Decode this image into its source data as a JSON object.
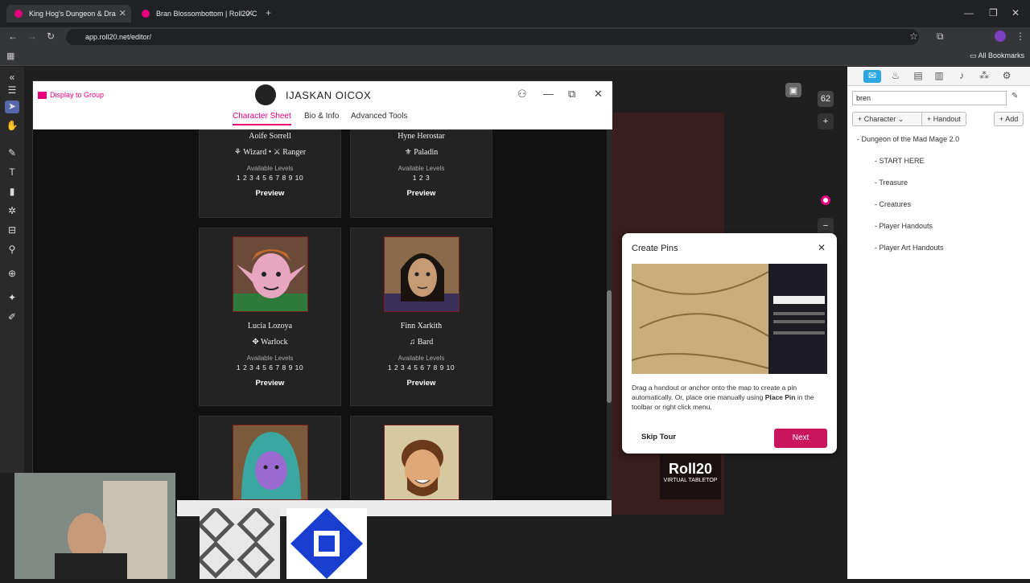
{
  "browser": {
    "tabs": [
      {
        "title": "King Hog's Dungeon & Dra",
        "active": true
      },
      {
        "title": "Bran Blossombottom | Roll20 C",
        "active": false
      }
    ],
    "new_tab": "+",
    "url": "app.roll20.net/editor/",
    "all_bookmarks": "All Bookmarks"
  },
  "dialog": {
    "display_to_group": "Display to Group",
    "title": "IJASKAN OICOX",
    "tabs": [
      "Character Sheet",
      "Bio & Info",
      "Advanced Tools"
    ],
    "available_levels_label": "Available Levels",
    "preview_label": "Preview",
    "cards": [
      {
        "name": "Aoife Sorrell",
        "classes": [
          "Wizard",
          "Ranger"
        ],
        "levels": "1 2 3 4 5 6 7 8 9 10"
      },
      {
        "name": "Hyne Herostar",
        "classes": [
          "Paladin"
        ],
        "levels": "1 2 3"
      },
      {
        "name": "Lucia Lozoya",
        "classes": [
          "Warlock"
        ],
        "levels": "1 2 3 4 5 6 7 8 9 10"
      },
      {
        "name": "Finn Xarkith",
        "classes": [
          "Bard"
        ],
        "levels": "1 2 3 4 5 6 7 8 9 10"
      }
    ]
  },
  "tour": {
    "title": "Create Pins",
    "text_before": "Drag a handout or anchor onto the map to create a pin automatically. Or, place one manually using ",
    "text_bold": "Place Pin",
    "text_after": " in the toolbar or right click menu.",
    "skip": "Skip Tour",
    "next": "Next"
  },
  "right_panel": {
    "search_value": "bren",
    "character_btn": "Character",
    "handout_btn": "+ Handout",
    "add_btn": "+ Add",
    "folder": "Dungeon of the Mad Mage 2.0",
    "items": [
      "START HERE",
      "Treasure",
      "Creatures",
      "Player Handouts",
      "Player Art Handouts"
    ]
  },
  "strip": {
    "page_count": "62",
    "add": "+"
  },
  "logo": {
    "line1": "Roll20",
    "line2": "VIRTUAL TABLETOP"
  },
  "colors": {
    "accent": "#e5007d",
    "next_button": "#c8155e",
    "card_bg": "#232323"
  }
}
